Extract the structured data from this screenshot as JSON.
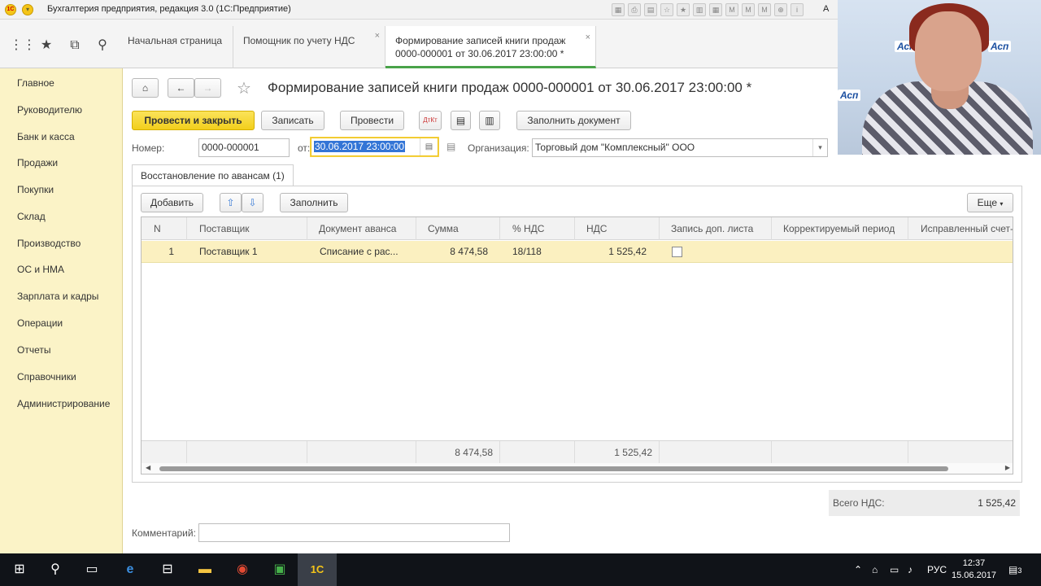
{
  "window": {
    "title": "Бухгалтерия предприятия, редакция 3.0  (1С:Предприятие)",
    "user": "А"
  },
  "topbar": {
    "tabs": [
      {
        "label": "Начальная страница"
      },
      {
        "label": "Помощник по учету НДС"
      },
      {
        "label_line1": "Формирование записей книги продаж",
        "label_line2": "0000-000001 от 30.06.2017 23:00:00 *"
      }
    ]
  },
  "sidebar": {
    "items": [
      {
        "label": "Главное"
      },
      {
        "label": "Руководителю"
      },
      {
        "label": "Банк и касса"
      },
      {
        "label": "Продажи"
      },
      {
        "label": "Покупки"
      },
      {
        "label": "Склад"
      },
      {
        "label": "Производство"
      },
      {
        "label": "ОС и НМА"
      },
      {
        "label": "Зарплата и кадры"
      },
      {
        "label": "Операции"
      },
      {
        "label": "Отчеты"
      },
      {
        "label": "Справочники"
      },
      {
        "label": "Администрирование"
      }
    ]
  },
  "document": {
    "title": "Формирование записей книги продаж 0000-000001 от 30.06.2017 23:00:00 *",
    "toolbar": {
      "post_and_close": "Провести и закрыть",
      "save": "Записать",
      "post": "Провести",
      "fill_document": "Заполнить документ"
    },
    "number_label": "Номер:",
    "number_value": "0000-000001",
    "date_label": "от:",
    "date_value": "30.06.2017 23:00:00",
    "org_label": "Организация:",
    "org_value": "Торговый дом \"Комплексный\" ООО",
    "subtab": "Восстановление по авансам (1)",
    "grid_toolbar": {
      "add": "Добавить",
      "fill": "Заполнить",
      "more": "Еще"
    },
    "columns": [
      "N",
      "Поставщик",
      "Документ аванса",
      "Сумма",
      "% НДС",
      "НДС",
      "Запись доп. листа",
      "Корректируемый период",
      "Исправленный счет-"
    ],
    "rows": [
      {
        "n": "1",
        "supplier": "Поставщик 1",
        "doc": "Списание с рас...",
        "sum": "8 474,58",
        "rate": "18/118",
        "vat": "1 525,42",
        "extra_sheet": false,
        "period": "",
        "invoice": ""
      }
    ],
    "footer": {
      "sum": "8 474,58",
      "vat": "1 525,42"
    },
    "total_label": "Всего НДС:",
    "total_value": "1 525,42",
    "comment_label": "Комментарий:",
    "comment_value": ""
  },
  "taskbar": {
    "lang": "РУС",
    "time": "12:37",
    "date": "15.06.2017",
    "notifications": "3"
  }
}
